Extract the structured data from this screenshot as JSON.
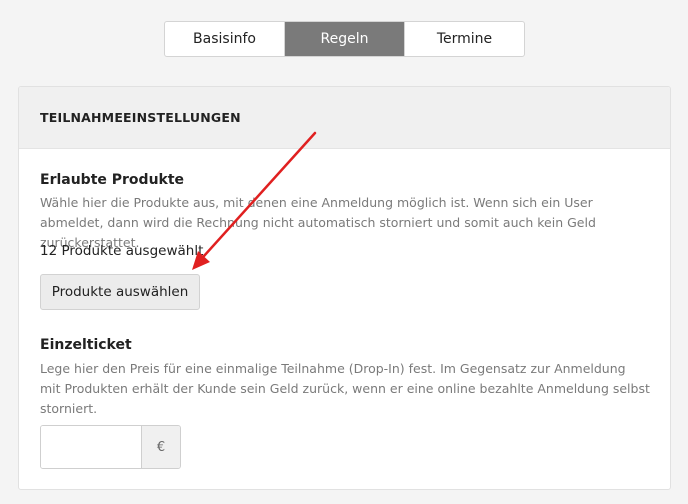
{
  "tabs": [
    {
      "label": "Basisinfo",
      "active": false
    },
    {
      "label": "Regeln",
      "active": true
    },
    {
      "label": "Termine",
      "active": false
    }
  ],
  "panel": {
    "header": "TEILNAHMEEINSTELLUNGEN",
    "products": {
      "title": "Erlaubte Produkte",
      "description": "Wähle hier die Produkte aus, mit denen eine Anmeldung möglich ist. Wenn sich ein User abmeldet, dann wird die Rechnung nicht automatisch storniert und somit auch kein Geld zurückerstattet.",
      "selected_count": "12 Produkte ausgewählt.",
      "select_button": "Produkte auswählen"
    },
    "single_ticket": {
      "title": "Einzelticket",
      "description": "Lege hier den Preis für eine einmalige Teilnahme (Drop-In) fest. Im Gegensatz zur Anmeldung mit Produkten erhält der Kunde sein Geld zurück, wenn er eine online bezahlte Anmeldung selbst storniert.",
      "price_value": "",
      "currency": "€"
    }
  },
  "annotation": {
    "arrow_color": "#e02020"
  }
}
